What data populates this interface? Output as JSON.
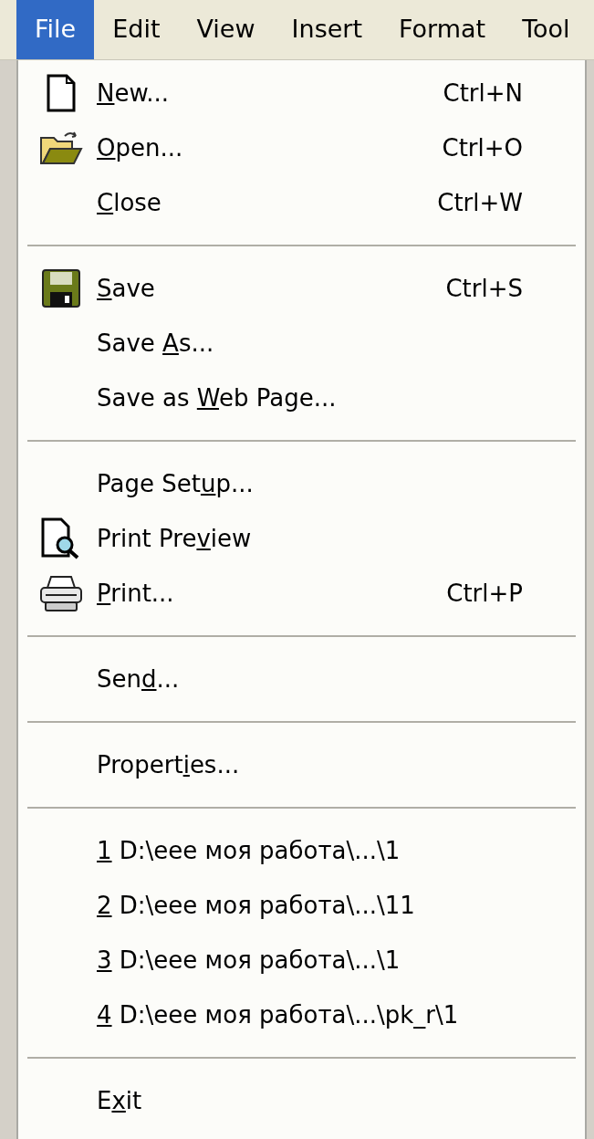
{
  "menu_bar": [
    {
      "label": "File",
      "selected": true
    },
    {
      "label": "Edit",
      "selected": false
    },
    {
      "label": "View",
      "selected": false
    },
    {
      "label": "Insert",
      "selected": false
    },
    {
      "label": "Format",
      "selected": false
    },
    {
      "label": "Tool",
      "selected": false
    }
  ],
  "file_menu": [
    {
      "kind": "document",
      "label": {
        "key": "N",
        "after": "ew..."
      },
      "shortcut": "Ctrl+N"
    },
    {
      "kind": "folder",
      "label": {
        "key": "O",
        "after": "pen..."
      },
      "shortcut": "Ctrl+O"
    },
    {
      "kind": "command",
      "label": {
        "key": "C",
        "after": "lose"
      },
      "shortcut": "Ctrl+W"
    },
    {
      "kind": "separator"
    },
    {
      "kind": "floppy",
      "label": {
        "key": "S",
        "after": "ave"
      },
      "shortcut": "Ctrl+S"
    },
    {
      "kind": "command",
      "label": {
        "before": "Save ",
        "key": "A",
        "after": "s..."
      }
    },
    {
      "kind": "command",
      "label": {
        "before": "Save as ",
        "key": "W",
        "after": "eb Page..."
      }
    },
    {
      "kind": "separator"
    },
    {
      "kind": "command",
      "label": {
        "before": "Page Set",
        "key": "u",
        "after": "p..."
      }
    },
    {
      "kind": "preview",
      "label": {
        "before": "Print Pre",
        "key": "v",
        "after": "iew"
      }
    },
    {
      "kind": "printer",
      "label": {
        "key": "P",
        "after": "rint..."
      },
      "shortcut": "Ctrl+P"
    },
    {
      "kind": "separator"
    },
    {
      "kind": "command",
      "label": {
        "before": "Sen",
        "key": "d",
        "after": "..."
      }
    },
    {
      "kind": "separator"
    },
    {
      "kind": "command",
      "label": {
        "before": "Propert",
        "key": "i",
        "after": "es..."
      }
    },
    {
      "kind": "separator"
    },
    {
      "kind": "command",
      "label": {
        "key": "1",
        "after": " D:\\eee моя работа\\...\\1"
      }
    },
    {
      "kind": "command",
      "label": {
        "key": "2",
        "after": " D:\\eee моя работа\\...\\11"
      }
    },
    {
      "kind": "command",
      "label": {
        "key": "3",
        "after": " D:\\eee моя работа\\...\\1"
      }
    },
    {
      "kind": "command",
      "label": {
        "key": "4",
        "after": " D:\\eee моя работа\\...\\pk_r\\1"
      }
    },
    {
      "kind": "separator"
    },
    {
      "kind": "command",
      "label": {
        "before": "E",
        "key": "x",
        "after": "it"
      }
    }
  ]
}
